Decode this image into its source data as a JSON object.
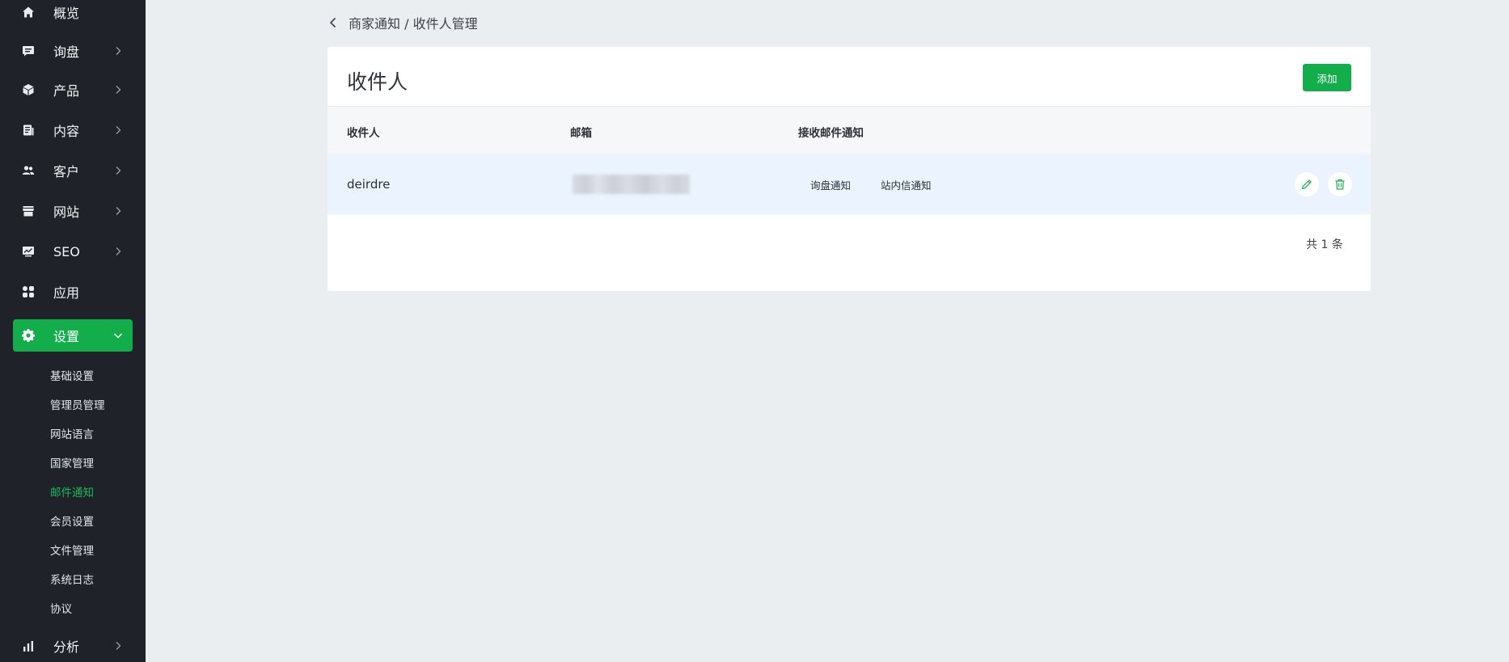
{
  "sidebar": {
    "items": [
      {
        "label": "概览",
        "icon": "home-icon"
      },
      {
        "label": "询盘",
        "icon": "message-icon"
      },
      {
        "label": "产品",
        "icon": "cube-icon"
      },
      {
        "label": "内容",
        "icon": "document-icon"
      },
      {
        "label": "客户",
        "icon": "users-icon"
      },
      {
        "label": "网站",
        "icon": "store-icon"
      },
      {
        "label": "SEO",
        "icon": "monitor-chart-icon"
      },
      {
        "label": "应用",
        "icon": "apps-icon"
      },
      {
        "label": "设置",
        "icon": "gear-icon"
      },
      {
        "label": "分析",
        "icon": "bar-chart-icon"
      }
    ],
    "settings_sub": [
      "基础设置",
      "管理员管理",
      "网站语言",
      "国家管理",
      "邮件通知",
      "会员设置",
      "文件管理",
      "系统日志",
      "协议"
    ],
    "active_sub": "邮件通知",
    "accent_color": "#13ad4c"
  },
  "breadcrumb": {
    "text": "商家通知 / 收件人管理"
  },
  "card": {
    "title": "收件人",
    "add_label": "添加",
    "columns": [
      "收件人",
      "邮箱",
      "接收邮件通知"
    ],
    "rows": [
      {
        "name": "deirdre",
        "tags": [
          "询盘通知",
          "站内信通知"
        ]
      }
    ],
    "total": "共 1 条"
  }
}
